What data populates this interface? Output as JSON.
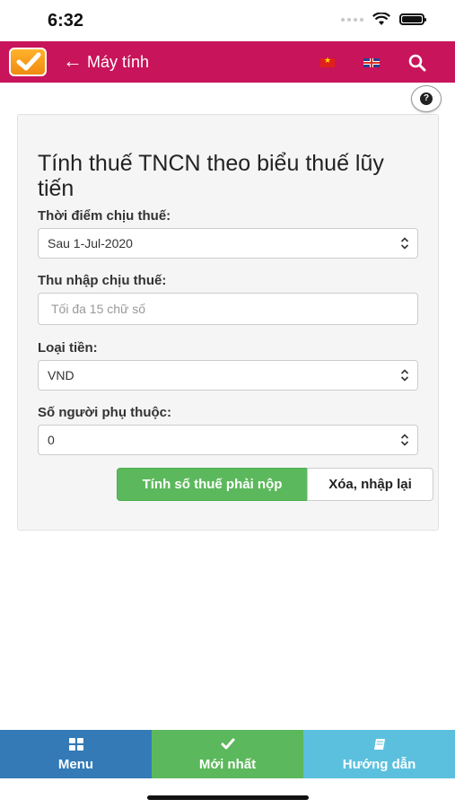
{
  "status_bar": {
    "time": "6:32"
  },
  "header": {
    "back_arrow": "←",
    "title": "Máy tính"
  },
  "help": {
    "label": "?"
  },
  "form": {
    "title": "Tính thuế TNCN theo biểu thuế lũy tiến",
    "tax_time": {
      "label": "Thời điểm chịu thuế:",
      "value": "Sau 1-Jul-2020"
    },
    "income": {
      "label": "Thu nhập chịu thuế:",
      "placeholder": "Tối đa 15 chữ số"
    },
    "currency": {
      "label": "Loại tiền:",
      "value": "VND"
    },
    "dependents": {
      "label": "Số người phụ thuộc:",
      "value": "0"
    },
    "calculate_label": "Tính số thuế phải nộp",
    "reset_label": "Xóa, nhập lại"
  },
  "bottom_nav": {
    "menu": "Menu",
    "latest": "Mới nhất",
    "guide": "Hướng dẫn"
  },
  "colors": {
    "header": "#c8145a",
    "primary_button": "#5cb85c",
    "nav_menu": "#337ab7",
    "nav_latest": "#5cb85c",
    "nav_guide": "#5bc0de"
  }
}
